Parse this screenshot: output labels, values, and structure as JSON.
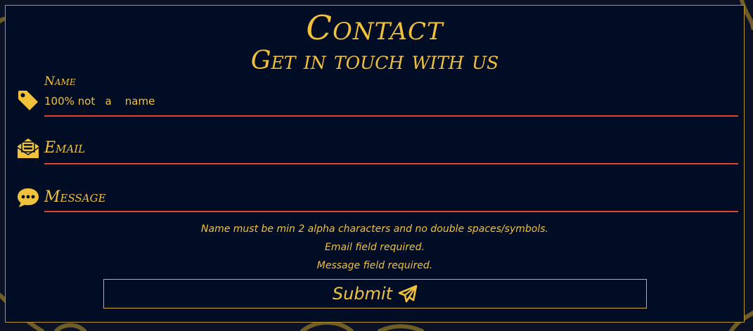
{
  "colors": {
    "background": "#0b1226",
    "panel": "#000d24",
    "accent": "#f2c13a",
    "underline": "#e0452e",
    "border": "#b69633"
  },
  "header": {
    "title": "Contact",
    "subtitle": "Get in touch with us"
  },
  "form": {
    "name": {
      "label": "Name",
      "value": "100% not   a    name",
      "icon": "tag-icon"
    },
    "email": {
      "label": "Email",
      "value": "",
      "icon": "envelope-open-icon"
    },
    "message": {
      "label": "Message",
      "value": "",
      "icon": "comment-dots-icon"
    },
    "errors": [
      "Name must be min 2 alpha characters and no double spaces/symbols.",
      "Email field required.",
      "Message field required."
    ],
    "submit": {
      "label": "Submit",
      "icon": "paper-plane-icon"
    }
  }
}
